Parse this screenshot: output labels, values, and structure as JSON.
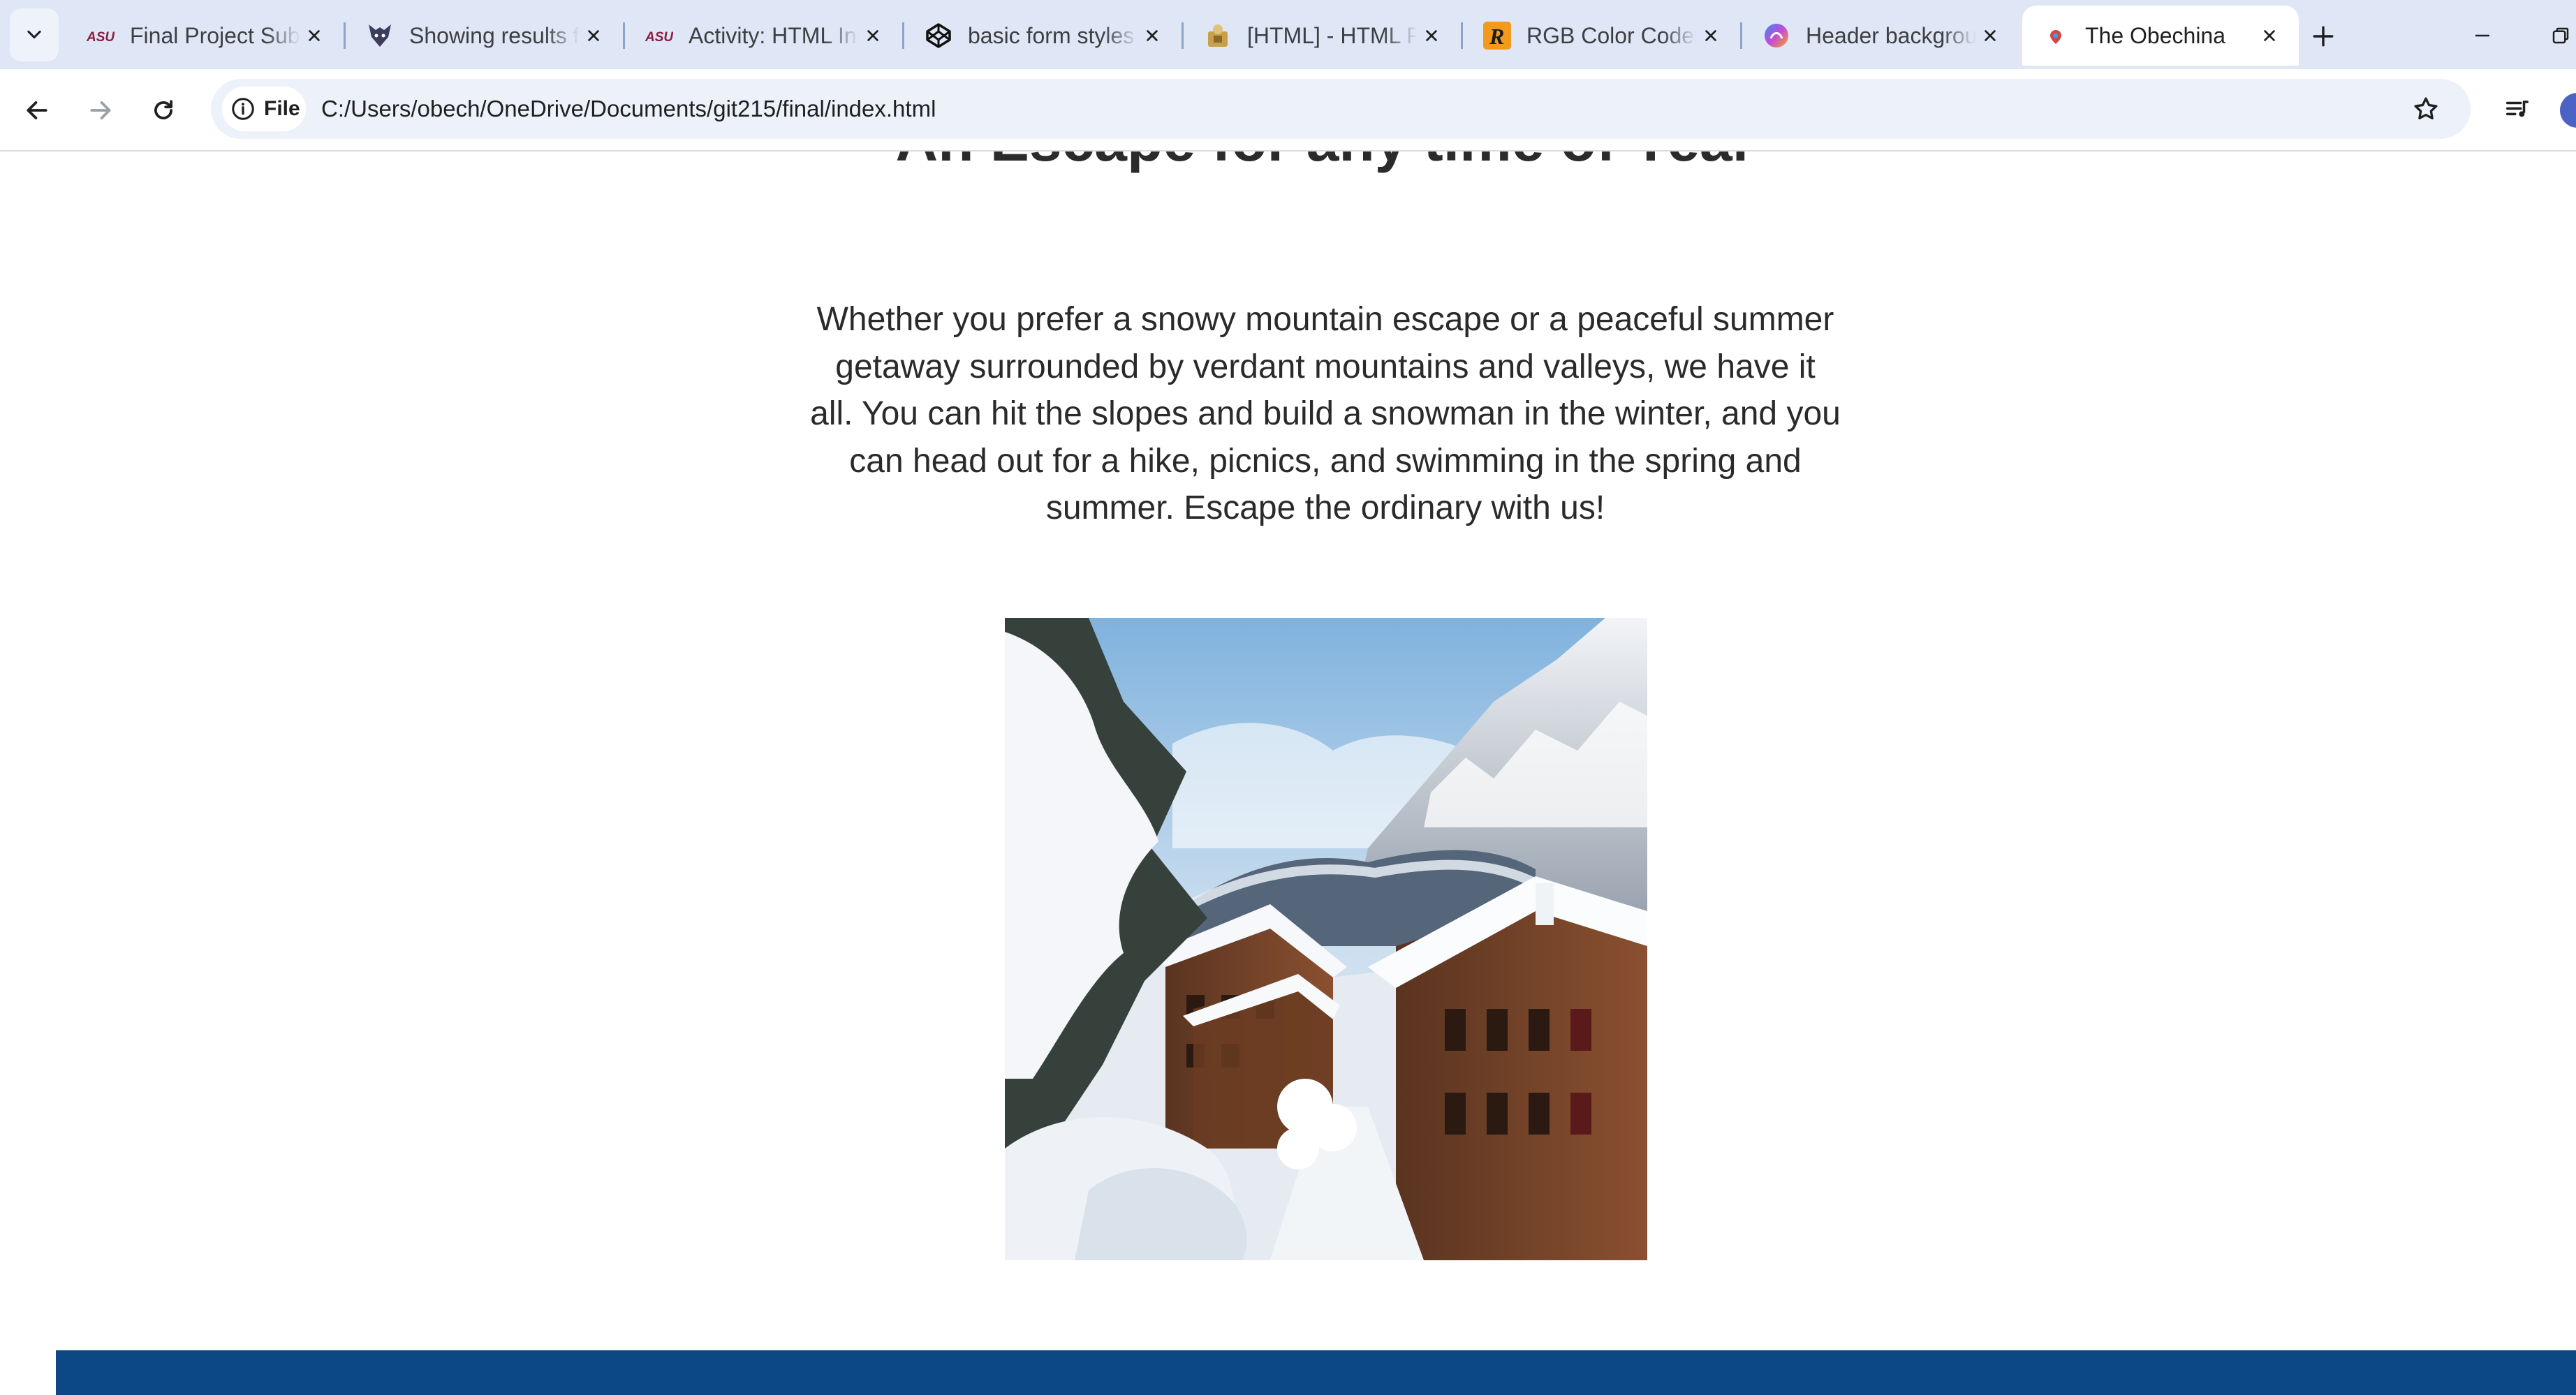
{
  "browser": {
    "tabs": [
      {
        "title": "Final Project Submission",
        "favicon": "asu-logo-icon",
        "active": false
      },
      {
        "title": "Showing results for",
        "favicon": "wolf-logo-icon",
        "active": false
      },
      {
        "title": "Activity: HTML Intro",
        "favicon": "asu-logo-icon",
        "active": false
      },
      {
        "title": "basic form styles",
        "favicon": "codepen-icon",
        "active": false
      },
      {
        "title": "[HTML] - HTML Forms",
        "favicon": "w3-icon",
        "active": false
      },
      {
        "title": "RGB Color Codes",
        "favicon": "rapidtables-icon",
        "active": false
      },
      {
        "title": "Header background",
        "favicon": "copilot-icon",
        "active": false
      },
      {
        "title": "The Obechina",
        "favicon": "page-icon",
        "active": true
      }
    ],
    "favicon_text": {
      "asu": "ASU",
      "rapidtables": "R"
    },
    "address": {
      "chip_label": "File",
      "url": "C:/Users/obech/OneDrive/Documents/git215/final/index.html"
    }
  },
  "page": {
    "heading": "An Escape for any time of Year",
    "paragraph": "Whether you prefer a snowy mountain escape or a peaceful summer getaway surrounded by verdant mountains and valleys, we have it all. You can hit the slopes and build a snowman in the winter, and you can head out for a hike, picnics, and swimming in the spring and summer. Escape the ordinary with us!",
    "image": {
      "subject": "snowy-alpine-village"
    }
  },
  "colors": {
    "tabstrip": "#dfe7f6",
    "omnibox": "#edf2fa",
    "footer_band": "#0c4883",
    "text": "#2a2a2a"
  }
}
